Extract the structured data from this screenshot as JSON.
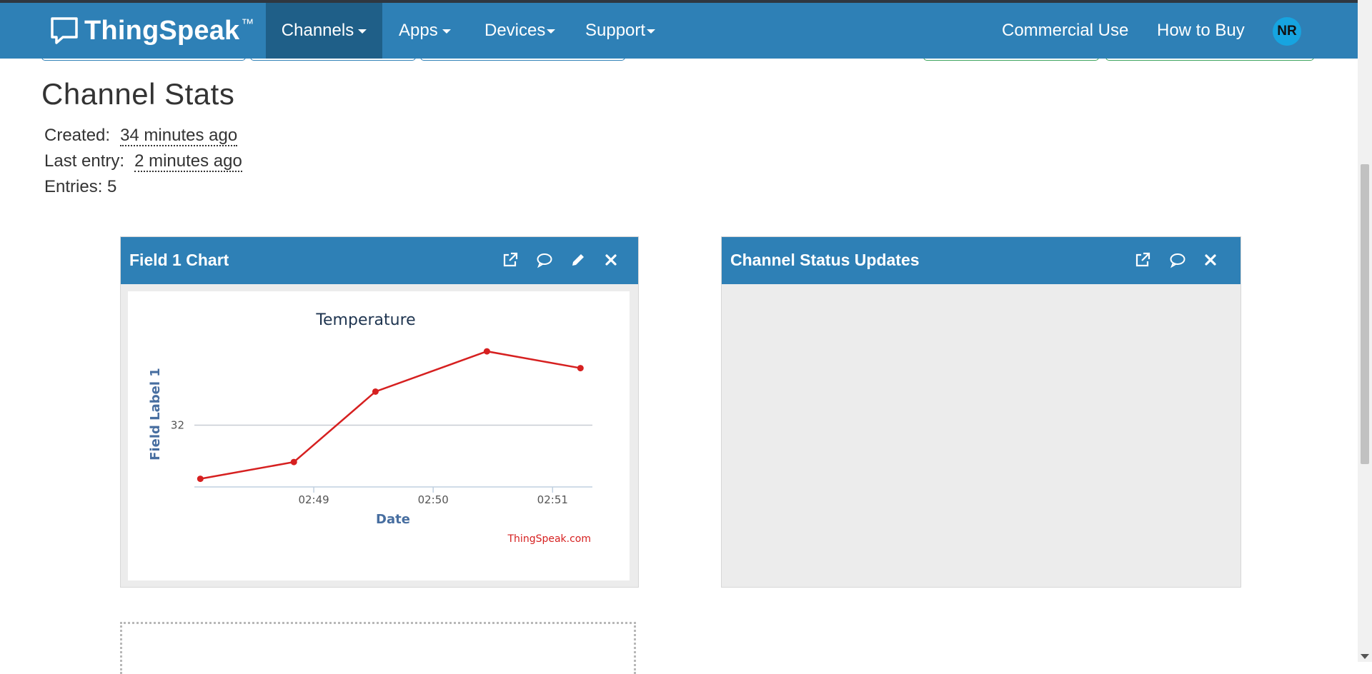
{
  "nav": {
    "brand": "ThingSpeak",
    "trademark": "™",
    "items": [
      {
        "label": "Channels",
        "active": true
      },
      {
        "label": "Apps",
        "active": false
      },
      {
        "label": "Devices",
        "active": false
      },
      {
        "label": "Support",
        "active": false
      }
    ],
    "commercial_use": "Commercial Use",
    "how_to_buy": "How to Buy",
    "avatar_initials": "NR",
    "color": "#2e80b6"
  },
  "stats": {
    "title": "Channel Stats",
    "created_label": "Created:",
    "created_value": "34 minutes ago",
    "last_entry_label": "Last entry:",
    "last_entry_value": "2 minutes ago",
    "entries_text": "Entries: 5"
  },
  "widgets": {
    "field1": {
      "title": "Field 1 Chart",
      "icons": [
        "external-link-icon",
        "comment-icon",
        "pencil-icon",
        "close-icon"
      ]
    },
    "status": {
      "title": "Channel Status Updates",
      "icons": [
        "external-link-icon",
        "comment-icon",
        "close-icon"
      ]
    }
  },
  "chart_data": {
    "type": "line",
    "title": "Temperature",
    "xlabel": "Date",
    "ylabel": "Field Label 1",
    "credit": "ThingSpeak.com",
    "x_ticks": [
      "02:49",
      "02:50",
      "02:51"
    ],
    "y_ticks": [
      32
    ],
    "series": [
      {
        "color": "#d62020",
        "points": [
          {
            "x": "02:48:03",
            "y": 31.2
          },
          {
            "x": "02:48:50",
            "y": 31.45
          },
          {
            "x": "02:49:31",
            "y": 32.5
          },
          {
            "x": "02:50:27",
            "y": 33.1
          },
          {
            "x": "02:51:14",
            "y": 32.85
          }
        ]
      }
    ],
    "grid": true
  }
}
